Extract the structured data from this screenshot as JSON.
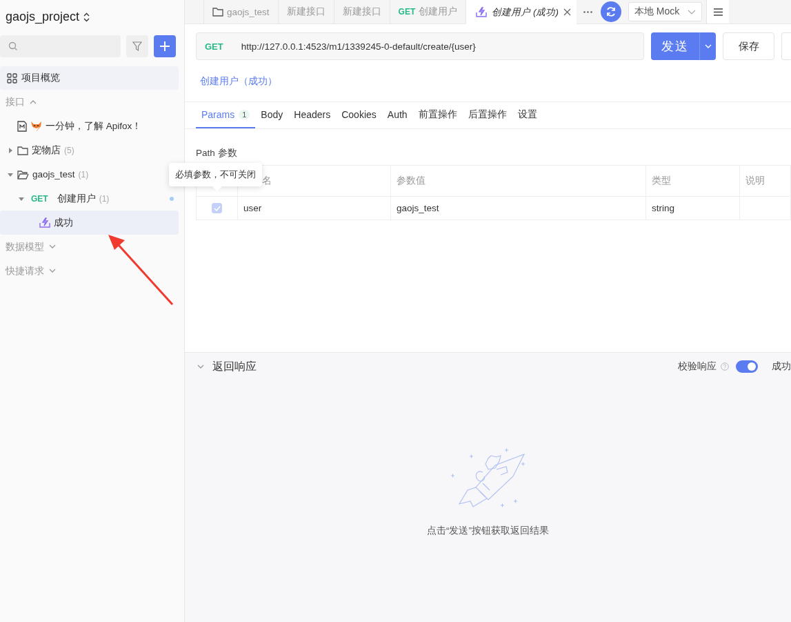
{
  "project": {
    "name": "gaojs_project"
  },
  "sidebar": {
    "overview": "项目概览",
    "sections": [
      {
        "title": "接口",
        "expanded": true,
        "items": [
          {
            "kind": "doc",
            "label": "一分钟，了解 Apifox！",
            "selected": false
          },
          {
            "kind": "folder",
            "label": "宠物店",
            "count": "(5)",
            "expanded": false,
            "selected": false
          },
          {
            "kind": "folder",
            "label": "gaojs_test",
            "count": "(1)",
            "expanded": true,
            "selected": false,
            "children": [
              {
                "kind": "endpoint",
                "method": "GET",
                "label": "创建用户",
                "count": "(1)",
                "expanded": true,
                "selected": false,
                "children": [
                  {
                    "kind": "case",
                    "label": "成功",
                    "selected": true
                  }
                ]
              }
            ]
          }
        ]
      },
      {
        "title": "数据模型",
        "expanded": false
      },
      {
        "title": "快捷请求",
        "expanded": false
      }
    ]
  },
  "tabs": [
    {
      "kind": "folder",
      "label": "gaojs_test",
      "selected": false
    },
    {
      "kind": "plain",
      "label": "新建接口",
      "selected": false
    },
    {
      "kind": "plain",
      "label": "新建接口",
      "selected": false
    },
    {
      "kind": "endpoint",
      "method": "GET",
      "label": "创建用户",
      "selected": false
    },
    {
      "kind": "case",
      "label": "创建用户 (成功)",
      "selected": true
    }
  ],
  "environment": {
    "label": "本地 Mock"
  },
  "request": {
    "method": "GET",
    "url": "http://127.0.0.1:4523/m1/1339245-0-default/create/{user}",
    "send": "发送",
    "save": "保存"
  },
  "breadcrumb": "创建用户（成功）",
  "param_tabs": [
    {
      "label": "Params",
      "badge": "1",
      "selected": true
    },
    {
      "label": "Body",
      "selected": false
    },
    {
      "label": "Headers",
      "selected": false
    },
    {
      "label": "Cookies",
      "selected": false
    },
    {
      "label": "Auth",
      "selected": false
    },
    {
      "label": "前置操作",
      "selected": false
    },
    {
      "label": "后置操作",
      "selected": false
    },
    {
      "label": "设置",
      "selected": false
    }
  ],
  "path_params": {
    "title": "Path 参数",
    "columns": [
      "名",
      "参数值",
      "类型",
      "说明"
    ],
    "rows": [
      {
        "checked": true,
        "disabled": true,
        "name": "user",
        "value": "gaojs_test",
        "type": "string"
      }
    ]
  },
  "tooltip": "必填参数，不可关闭",
  "response": {
    "title": "返回响应",
    "expanded": true,
    "validate_label": "校验响应",
    "validate_on": true,
    "case_label": "成功",
    "empty_text": "点击“发送”按钮获取返回结果"
  }
}
